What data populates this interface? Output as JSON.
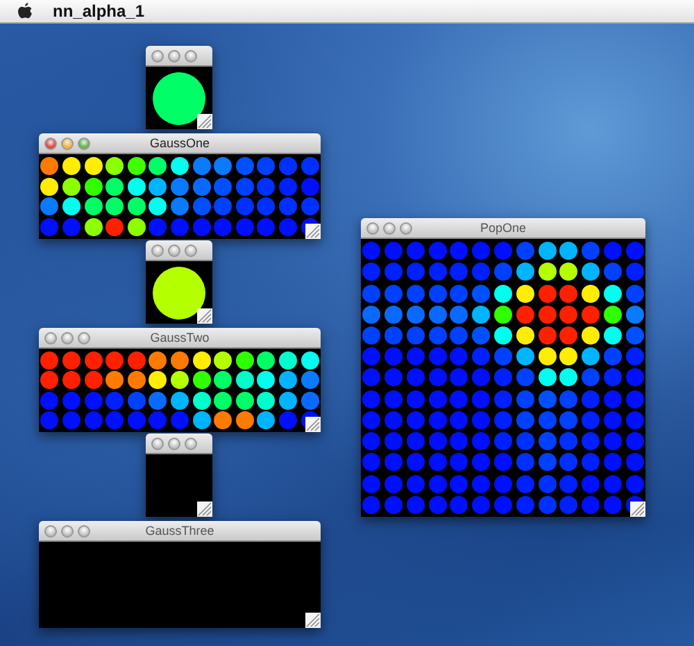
{
  "menu_bar": {
    "app_name": "nn_alpha_1"
  },
  "windows": [
    {
      "kind": "swatch",
      "active": false,
      "color": "#00ff66"
    },
    {
      "kind": "grid",
      "title": "GaussOne",
      "active": true,
      "rows": [
        [
          {
            "color": "#ff7a00"
          },
          {
            "color": "#ffee00"
          },
          {
            "color": "#ffee00"
          },
          {
            "color": "#8cff00"
          },
          {
            "color": "#40ff00"
          },
          {
            "color": "#00ff66"
          },
          {
            "color": "#00ffee"
          },
          {
            "color": "#0a7aff"
          },
          {
            "color": "#0a7aff"
          },
          {
            "color": "#0050ff"
          },
          {
            "color": "#0040ff"
          },
          {
            "color": "#0030ff"
          },
          {
            "color": "#0030ff"
          }
        ],
        [
          {
            "color": "#ffee00"
          },
          {
            "color": "#8cff00"
          },
          {
            "color": "#30ff00"
          },
          {
            "color": "#00ff66"
          },
          {
            "color": "#00ffee"
          },
          {
            "color": "#00b4ff"
          },
          {
            "color": "#0a7aff"
          },
          {
            "color": "#0a6aff"
          },
          {
            "color": "#0050ff"
          },
          {
            "color": "#0040ff"
          },
          {
            "color": "#0030ff"
          },
          {
            "color": "#0020ff"
          },
          {
            "color": "#0010ff"
          }
        ],
        [
          {
            "color": "#0a7aff"
          },
          {
            "color": "#00ffee"
          },
          {
            "color": "#00ff66"
          },
          {
            "color": "#00ff66"
          },
          {
            "color": "#00ff66"
          },
          {
            "color": "#00ffee"
          },
          {
            "color": "#0a7aff"
          },
          {
            "color": "#0050ff"
          },
          {
            "color": "#0040ff"
          },
          {
            "color": "#0030ff"
          },
          {
            "color": "#0030ff"
          },
          {
            "color": "#0030ff"
          },
          {
            "color": "#0030ff"
          }
        ],
        [
          {
            "color": "#0010ff"
          },
          {
            "color": "#0010ff"
          },
          {
            "color": "#8cff00"
          },
          {
            "color": "#ff2000"
          },
          {
            "color": "#8cff00"
          },
          {
            "color": "#0010ff"
          },
          {
            "color": "#0010ff"
          },
          {
            "color": "#0010ff"
          },
          {
            "color": "#0010ff"
          },
          {
            "color": "#0010ff"
          },
          {
            "color": "#0010ff"
          },
          {
            "color": "#0010ff"
          },
          {
            "color": "#0010ff"
          }
        ]
      ]
    },
    {
      "kind": "swatch",
      "active": false,
      "color": "#b4ff00"
    },
    {
      "kind": "grid",
      "title": "GaussTwo",
      "active": false,
      "rows": [
        [
          {
            "color": "#ff2000"
          },
          {
            "color": "#ff2000"
          },
          {
            "color": "#ff2000"
          },
          {
            "color": "#ff2000"
          },
          {
            "color": "#ff2000"
          },
          {
            "color": "#ff7a00"
          },
          {
            "color": "#ff7a00"
          },
          {
            "color": "#ffee00"
          },
          {
            "color": "#b4ff00"
          },
          {
            "color": "#30ff00"
          },
          {
            "color": "#00ff66"
          },
          {
            "color": "#00ffcc"
          },
          {
            "color": "#00ffee"
          }
        ],
        [
          {
            "color": "#ff2000"
          },
          {
            "color": "#ff2000"
          },
          {
            "color": "#ff2000"
          },
          {
            "color": "#ff7a00"
          },
          {
            "color": "#ff7a00"
          },
          {
            "color": "#ffee00"
          },
          {
            "color": "#b4ff00"
          },
          {
            "color": "#30ff00"
          },
          {
            "color": "#00ff66"
          },
          {
            "color": "#00ffcc"
          },
          {
            "color": "#00ffee"
          },
          {
            "color": "#00b4ff"
          },
          {
            "color": "#0a7aff"
          }
        ],
        [
          {
            "color": "#0010ff"
          },
          {
            "color": "#0010ff"
          },
          {
            "color": "#0010ff"
          },
          {
            "color": "#0020ff"
          },
          {
            "color": "#0040ff"
          },
          {
            "color": "#0a6aff"
          },
          {
            "color": "#00b4ff"
          },
          {
            "color": "#00ffcc"
          },
          {
            "color": "#00ff66"
          },
          {
            "color": "#00ff66"
          },
          {
            "color": "#00ffcc"
          },
          {
            "color": "#00b4ff"
          },
          {
            "color": "#0a6aff"
          }
        ],
        [
          {
            "color": "#0010ff"
          },
          {
            "color": "#0010ff"
          },
          {
            "color": "#0010ff"
          },
          {
            "color": "#0010ff"
          },
          {
            "color": "#0010ff"
          },
          {
            "color": "#0010ff"
          },
          {
            "color": "#0010ff"
          },
          {
            "color": "#00b4ff"
          },
          {
            "color": "#ff7a00"
          },
          {
            "color": "#ff7a00"
          },
          {
            "color": "#00b4ff"
          },
          {
            "color": "#0010ff"
          },
          {
            "color": "#0010ff"
          }
        ]
      ]
    },
    {
      "kind": "swatch",
      "active": false
    },
    {
      "kind": "grid",
      "title": "GaussThree",
      "active": false
    },
    {
      "kind": "grid",
      "title": "PopOne",
      "active": false,
      "rows": [
        [
          {
            "color": "#0010ff"
          },
          {
            "color": "#0010ff"
          },
          {
            "color": "#0010ff"
          },
          {
            "color": "#0010ff"
          },
          {
            "color": "#0010ff"
          },
          {
            "color": "#0010ff"
          },
          {
            "color": "#0010ff"
          },
          {
            "color": "#0040ff"
          },
          {
            "color": "#00b4ff"
          },
          {
            "color": "#00b4ff"
          },
          {
            "color": "#0040ff"
          },
          {
            "color": "#0010ff"
          },
          {
            "color": "#0010ff"
          }
        ],
        [
          {
            "color": "#0020ff"
          },
          {
            "color": "#0020ff"
          },
          {
            "color": "#0020ff"
          },
          {
            "color": "#0020ff"
          },
          {
            "color": "#0020ff"
          },
          {
            "color": "#0020ff"
          },
          {
            "color": "#0040ff"
          },
          {
            "color": "#00b4ff"
          },
          {
            "color": "#b4ff00"
          },
          {
            "color": "#b4ff00"
          },
          {
            "color": "#00b4ff"
          },
          {
            "color": "#0040ff"
          },
          {
            "color": "#0020ff"
          }
        ],
        [
          {
            "color": "#0040ff"
          },
          {
            "color": "#0040ff"
          },
          {
            "color": "#0040ff"
          },
          {
            "color": "#0040ff"
          },
          {
            "color": "#0040ff"
          },
          {
            "color": "#0050ff"
          },
          {
            "color": "#00ffee"
          },
          {
            "color": "#ffee00"
          },
          {
            "color": "#ff2000"
          },
          {
            "color": "#ff2000"
          },
          {
            "color": "#ffee00"
          },
          {
            "color": "#00ffee"
          },
          {
            "color": "#0040ff"
          }
        ],
        [
          {
            "color": "#0a6aff"
          },
          {
            "color": "#0a6aff"
          },
          {
            "color": "#0a6aff"
          },
          {
            "color": "#0a6aff"
          },
          {
            "color": "#0a6aff"
          },
          {
            "color": "#00b4ff"
          },
          {
            "color": "#30ff00"
          },
          {
            "color": "#ff2000"
          },
          {
            "color": "#ff2000"
          },
          {
            "color": "#ff2000"
          },
          {
            "color": "#ff2000"
          },
          {
            "color": "#30ff00"
          },
          {
            "color": "#0a7aff"
          }
        ],
        [
          {
            "color": "#0040ff"
          },
          {
            "color": "#0040ff"
          },
          {
            "color": "#0040ff"
          },
          {
            "color": "#0040ff"
          },
          {
            "color": "#0040ff"
          },
          {
            "color": "#0050ff"
          },
          {
            "color": "#00ffee"
          },
          {
            "color": "#ffee00"
          },
          {
            "color": "#ff2000"
          },
          {
            "color": "#ff2000"
          },
          {
            "color": "#ffee00"
          },
          {
            "color": "#00ffee"
          },
          {
            "color": "#0050ff"
          }
        ],
        [
          {
            "color": "#0010ff"
          },
          {
            "color": "#0010ff"
          },
          {
            "color": "#0010ff"
          },
          {
            "color": "#0010ff"
          },
          {
            "color": "#0010ff"
          },
          {
            "color": "#0020ff"
          },
          {
            "color": "#0040ff"
          },
          {
            "color": "#00b4ff"
          },
          {
            "color": "#ffee00"
          },
          {
            "color": "#ffee00"
          },
          {
            "color": "#00b4ff"
          },
          {
            "color": "#0040ff"
          },
          {
            "color": "#0020ff"
          }
        ],
        [
          {
            "color": "#0010ff"
          },
          {
            "color": "#0010ff"
          },
          {
            "color": "#0010ff"
          },
          {
            "color": "#0010ff"
          },
          {
            "color": "#0010ff"
          },
          {
            "color": "#0010ff"
          },
          {
            "color": "#0020ff"
          },
          {
            "color": "#0040ff"
          },
          {
            "color": "#00ffee"
          },
          {
            "color": "#00ffee"
          },
          {
            "color": "#0040ff"
          },
          {
            "color": "#0020ff"
          },
          {
            "color": "#0010ff"
          }
        ],
        [
          {
            "color": "#0010ff"
          },
          {
            "color": "#0010ff"
          },
          {
            "color": "#0010ff"
          },
          {
            "color": "#0010ff"
          },
          {
            "color": "#0010ff"
          },
          {
            "color": "#0010ff"
          },
          {
            "color": "#0020ff"
          },
          {
            "color": "#0040ff"
          },
          {
            "color": "#0050ff"
          },
          {
            "color": "#0040ff"
          },
          {
            "color": "#0020ff"
          },
          {
            "color": "#0010ff"
          },
          {
            "color": "#0010ff"
          }
        ],
        [
          {
            "color": "#0010ff"
          },
          {
            "color": "#0010ff"
          },
          {
            "color": "#0010ff"
          },
          {
            "color": "#0010ff"
          },
          {
            "color": "#0010ff"
          },
          {
            "color": "#0010ff"
          },
          {
            "color": "#0020ff"
          },
          {
            "color": "#0040ff"
          },
          {
            "color": "#0040ff"
          },
          {
            "color": "#0040ff"
          },
          {
            "color": "#0020ff"
          },
          {
            "color": "#0010ff"
          },
          {
            "color": "#0010ff"
          }
        ],
        [
          {
            "color": "#0010ff"
          },
          {
            "color": "#0010ff"
          },
          {
            "color": "#0010ff"
          },
          {
            "color": "#0010ff"
          },
          {
            "color": "#0010ff"
          },
          {
            "color": "#0010ff"
          },
          {
            "color": "#0020ff"
          },
          {
            "color": "#0030ff"
          },
          {
            "color": "#0040ff"
          },
          {
            "color": "#0030ff"
          },
          {
            "color": "#0020ff"
          },
          {
            "color": "#0010ff"
          },
          {
            "color": "#0010ff"
          }
        ],
        [
          {
            "color": "#0010ff"
          },
          {
            "color": "#0010ff"
          },
          {
            "color": "#0010ff"
          },
          {
            "color": "#0010ff"
          },
          {
            "color": "#0010ff"
          },
          {
            "color": "#0010ff"
          },
          {
            "color": "#0010ff"
          },
          {
            "color": "#0030ff"
          },
          {
            "color": "#0040ff"
          },
          {
            "color": "#0030ff"
          },
          {
            "color": "#0020ff"
          },
          {
            "color": "#0010ff"
          },
          {
            "color": "#0010ff"
          }
        ],
        [
          {
            "color": "#0010ff"
          },
          {
            "color": "#0010ff"
          },
          {
            "color": "#0010ff"
          },
          {
            "color": "#0010ff"
          },
          {
            "color": "#0010ff"
          },
          {
            "color": "#0010ff"
          },
          {
            "color": "#0010ff"
          },
          {
            "color": "#0020ff"
          },
          {
            "color": "#0030ff"
          },
          {
            "color": "#0020ff"
          },
          {
            "color": "#0010ff"
          },
          {
            "color": "#0010ff"
          },
          {
            "color": "#0010ff"
          }
        ],
        [
          {
            "color": "#0010ff"
          },
          {
            "color": "#0010ff"
          },
          {
            "color": "#0010ff"
          },
          {
            "color": "#0010ff"
          },
          {
            "color": "#0010ff"
          },
          {
            "color": "#0010ff"
          },
          {
            "color": "#0010ff"
          },
          {
            "color": "#0020ff"
          },
          {
            "color": "#0030ff"
          },
          {
            "color": "#0020ff"
          },
          {
            "color": "#0010ff"
          },
          {
            "color": "#0010ff"
          },
          {
            "color": "#0010ff"
          }
        ]
      ]
    }
  ]
}
